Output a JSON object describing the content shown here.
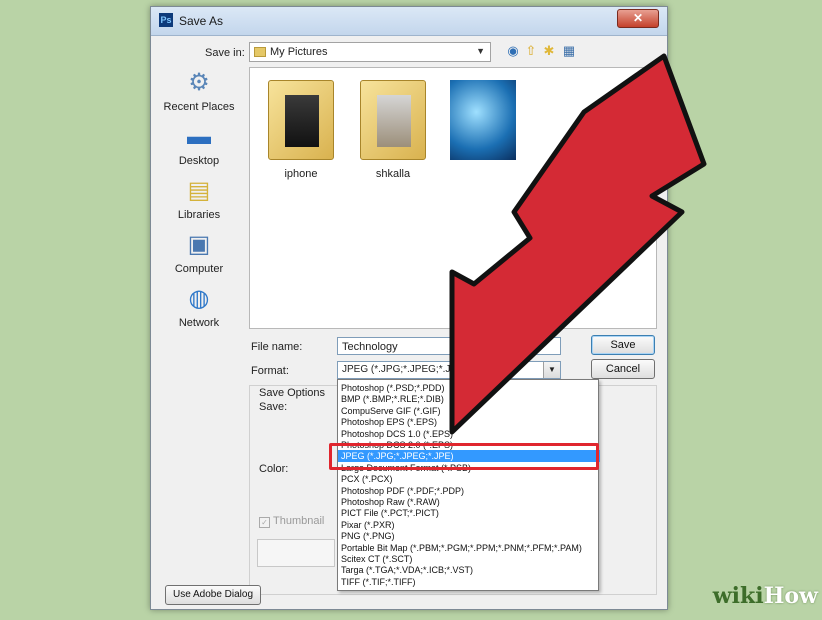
{
  "dialog": {
    "title": "Save As",
    "app_icon_text": "Ps",
    "close_glyph": "✕"
  },
  "toolbar": {
    "save_in_label": "Save in:",
    "location": "My Pictures",
    "icons": [
      "back-icon",
      "up-folder-icon",
      "new-folder-icon",
      "view-menu-icon"
    ]
  },
  "places": [
    {
      "label": "Recent Places",
      "icon": "recent-places-icon"
    },
    {
      "label": "Desktop",
      "icon": "desktop-icon"
    },
    {
      "label": "Libraries",
      "icon": "libraries-icon"
    },
    {
      "label": "Computer",
      "icon": "computer-icon"
    },
    {
      "label": "Network",
      "icon": "network-icon"
    }
  ],
  "files": [
    {
      "label": "iphone"
    },
    {
      "label": "shkalla"
    },
    {
      "label": ""
    }
  ],
  "form": {
    "file_name_label": "File name:",
    "file_name_value": "Technology",
    "format_label": "Format:",
    "format_value": "JPEG (*.JPG;*.JPEG;*.JPE)",
    "save_button": "Save",
    "cancel_button": "Cancel"
  },
  "options": {
    "save_options_label": "Save Options",
    "save_label": "Save:",
    "color_label": "Color:",
    "thumbnail_label": "Thumbnail",
    "use_adobe_dialog": "Use Adobe Dialog"
  },
  "format_list": [
    "Photoshop (*.PSD;*.PDD)",
    "BMP (*.BMP;*.RLE;*.DIB)",
    "CompuServe GIF (*.GIF)",
    "Photoshop EPS (*.EPS)",
    "Photoshop DCS 1.0 (*.EPS)",
    "Photoshop DCS 2.0 (*.EPS)",
    "JPEG (*.JPG;*.JPEG;*.JPE)",
    "Large Document Format (*.PSB)",
    "PCX (*.PCX)",
    "Photoshop PDF (*.PDF;*.PDP)",
    "Photoshop Raw (*.RAW)",
    "PICT File (*.PCT;*.PICT)",
    "Pixar (*.PXR)",
    "PNG (*.PNG)",
    "Portable Bit Map (*.PBM;*.PGM;*.PPM;*.PNM;*.PFM;*.PAM)",
    "Scitex CT (*.SCT)",
    "Targa (*.TGA;*.VDA;*.ICB;*.VST)",
    "TIFF (*.TIF;*.TIFF)"
  ],
  "selected_format_index": 6,
  "colors": {
    "background": "#b9d3a6",
    "arrow_fill": "#d42a35",
    "highlight_border": "#e0262e",
    "selection": "#3399ff"
  },
  "watermark": {
    "wiki": "wiki",
    "how": "How"
  }
}
